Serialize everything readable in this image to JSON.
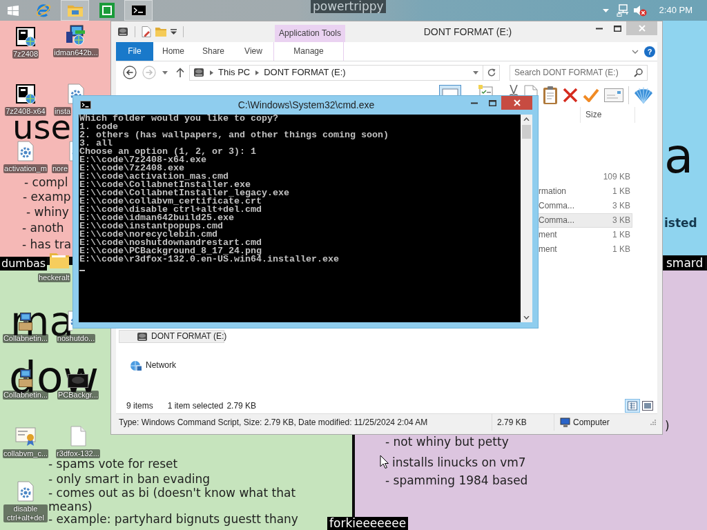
{
  "taskbar": {
    "apps": [
      {
        "kind": "browser",
        "selected": false
      },
      {
        "kind": "files",
        "selected": true
      },
      {
        "kind": "sheet",
        "selected": false
      },
      {
        "kind": "console",
        "selected": true
      }
    ],
    "volume": {
      "muted": true
    },
    "clock": "2:40 PM"
  },
  "wallpaper": {
    "panels": [
      {
        "color": "#f5b8b6",
        "texts": [
          {
            "kind": "heading",
            "text": "use"
          },
          {
            "kind": "line",
            "text": "- compl"
          },
          {
            "kind": "line",
            "text": "- examp"
          },
          {
            "kind": "line",
            "text": "- whiny"
          },
          {
            "kind": "line",
            "text": "- anoth"
          },
          {
            "kind": "line",
            "text": "- has tra"
          }
        ]
      },
      {
        "color": "#8fd4ef",
        "texts": [
          {
            "kind": "heading",
            "text": "a"
          },
          {
            "kind": "line",
            "text": "isted"
          }
        ]
      },
      {
        "color": "#c6e4bd",
        "texts": [
          {
            "kind": "heading",
            "text": "ma"
          },
          {
            "kind": "heading",
            "text": "dow"
          },
          {
            "kind": "line",
            "text": "- spams vote for reset"
          },
          {
            "kind": "line",
            "text": "- only smart in ban evading"
          },
          {
            "kind": "line",
            "text": "- comes out as bi (doesn't know what that means)"
          },
          {
            "kind": "line",
            "text": "- example: partyhard bignuts guestt thany"
          }
        ]
      },
      {
        "color": "#dcc5df",
        "texts": [
          {
            "kind": "line",
            "text": ")"
          },
          {
            "kind": "line",
            "text": "- not whiny but petty"
          },
          {
            "kind": "line",
            "text": "installs linucks on vm7"
          },
          {
            "kind": "line",
            "text": "- spamming 1984 based"
          }
        ]
      }
    ],
    "tags": [
      "powertrippy",
      "dumbas",
      "smard",
      "forkieeeeeee"
    ]
  },
  "desktop_icons": [
    {
      "label": "7z2408",
      "kind": "archiver"
    },
    {
      "label": "idman642b...",
      "kind": "installer"
    },
    {
      "label": "7z2408-x64",
      "kind": "archiver"
    },
    {
      "label": "insta",
      "kind": "script"
    },
    {
      "label": "activation_m",
      "kind": "script"
    },
    {
      "label": "nore",
      "kind": "script"
    },
    {
      "label": "heckeralt",
      "kind": "folder"
    },
    {
      "label": "Collabnetin...",
      "kind": "setup"
    },
    {
      "label": "noshutdo...",
      "kind": "script"
    },
    {
      "label": "Collabnetin...",
      "kind": "setup"
    },
    {
      "label": "PCBackgr...",
      "kind": "image"
    },
    {
      "label": "collabvm_c...",
      "kind": "certificate"
    },
    {
      "label": "r3dfox-132...",
      "kind": "document"
    },
    {
      "label": "disable ctrl+alt+del",
      "kind": "script"
    }
  ],
  "explorer": {
    "title": "DONT FORMAT (E:)",
    "tool_group": "Application Tools",
    "tabs": [
      {
        "label": "File",
        "kind": "backstage"
      },
      {
        "label": "Home",
        "kind": "standard"
      },
      {
        "label": "Share",
        "kind": "standard"
      },
      {
        "label": "View",
        "kind": "standard"
      },
      {
        "label": "Manage",
        "kind": "contextual"
      }
    ],
    "help": "?",
    "address": [
      "This PC",
      "DONT FORMAT (E:)"
    ],
    "search": {
      "placeholder": "Search DONT FORMAT (E:)"
    },
    "nav": [
      {
        "label": "DONT FORMAT (E:)",
        "kind": "drive",
        "selected": true
      },
      {
        "label": "Network",
        "kind": "network",
        "selected": false
      }
    ],
    "columns": [
      {
        "label": "Size"
      }
    ],
    "rows": [
      {
        "size": "109 KB",
        "selected": false
      },
      {
        "column_1": "rmation",
        "size": "1 KB",
        "selected": false
      },
      {
        "column_1": "Comma...",
        "size": "3 KB",
        "selected": false
      },
      {
        "column_1": "Comma...",
        "size": "3 KB",
        "selected": true
      },
      {
        "column_1": "ment",
        "size": "1 KB",
        "selected": false
      },
      {
        "column_1": "ment",
        "size": "1 KB",
        "selected": false
      }
    ],
    "status": {
      "items": "9 items",
      "selection": "1 item selected",
      "selection_size": "2.79 KB",
      "views": [
        {
          "kind": "details",
          "selected": true
        },
        {
          "kind": "tiles",
          "selected": false
        }
      ]
    },
    "details": {
      "summary": "Type: Windows Command Script, Size: 2.79 KB, Date modified: 11/25/2024 2:04 AM",
      "size": "2.79 KB",
      "location": "Computer"
    }
  },
  "console": {
    "title": "C:\\Windows\\System32\\cmd.exe",
    "lines": [
      "Which folder would you like to copy?",
      "1. code",
      "2. others (has wallpapers, and other things coming soon)",
      "3. all",
      "Choose an option (1, 2, or 3): 1",
      "E:\\\\code\\7z2408-x64.exe",
      "E:\\\\code\\7z2408.exe",
      "E:\\\\code\\activation_mas.cmd",
      "E:\\\\code\\CollabnetInstaller.exe",
      "E:\\\\code\\CollabnetInstaller_legacy.exe",
      "E:\\\\code\\collabvm_certificate.crt",
      "E:\\\\code\\disable ctrl+alt+del.cmd",
      "E:\\\\code\\idman642build25.exe",
      "E:\\\\code\\instantpopups.cmd",
      "E:\\\\code\\norecyclebin.cmd",
      "E:\\\\code\\noshutdownandrestart.cmd",
      "E:\\\\code\\PCBackground_8_17_24.png",
      "E:\\\\code\\r3dfox-132.0.en-US.win64.installer.exe"
    ]
  }
}
